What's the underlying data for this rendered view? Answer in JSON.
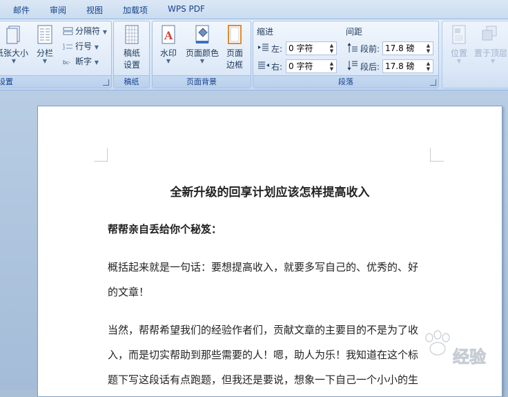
{
  "menu": {
    "tabs": [
      "邮件",
      "审阅",
      "视图",
      "加载项",
      "WPS PDF"
    ]
  },
  "ribbon": {
    "page_setup": {
      "paper_size_label": "纸张大小",
      "columns_label": "分栏",
      "separator_label": "分隔符",
      "line_numbers_label": "行号",
      "hyphenation_label": "断字",
      "group_title": "设置"
    },
    "manuscript": {
      "button_label_1": "稿纸",
      "button_label_2": "设置",
      "group_title": "稿纸"
    },
    "page_background": {
      "watermark_label": "水印",
      "page_color_label": "页面颜色",
      "page_border_label_1": "页面",
      "page_border_label_2": "边框",
      "group_title": "页面背景"
    },
    "paragraph": {
      "indent_title": "缩进",
      "indent_left_label": "左:",
      "indent_left_value": "0 字符",
      "indent_right_label": "右:",
      "indent_right_value": "0 字符",
      "spacing_title": "间距",
      "spacing_before_label": "段前:",
      "spacing_before_value": "17.8 磅",
      "spacing_after_label": "段后:",
      "spacing_after_value": "17.8 磅",
      "group_title": "段落"
    },
    "arrange": {
      "position_label": "位置",
      "bring_front_label": "置于顶层"
    }
  },
  "document": {
    "title": "全新升级的回享计划应该怎样提高收入",
    "heading": "帮帮亲自丢给你个秘笈：",
    "lines": [
      "概括起来就是一句话：要想提高收入，就要多写自己的、优秀的、好",
      "的文章！",
      "当然，帮帮希望我们的经验作者们，贡献文章的主要目的不是为了收",
      "入，而是切实帮助到那些需要的人！嗯，助人为乐！我知道在这个标",
      "题下写这段话有点跑题，但我还是要说，想象一下自己一个小小的生"
    ],
    "watermark_text": "经验"
  },
  "colors": {
    "accent": "#15428b",
    "ribbon_bg": "#dfeaf8",
    "doc_bg": "#a9bfd6"
  }
}
